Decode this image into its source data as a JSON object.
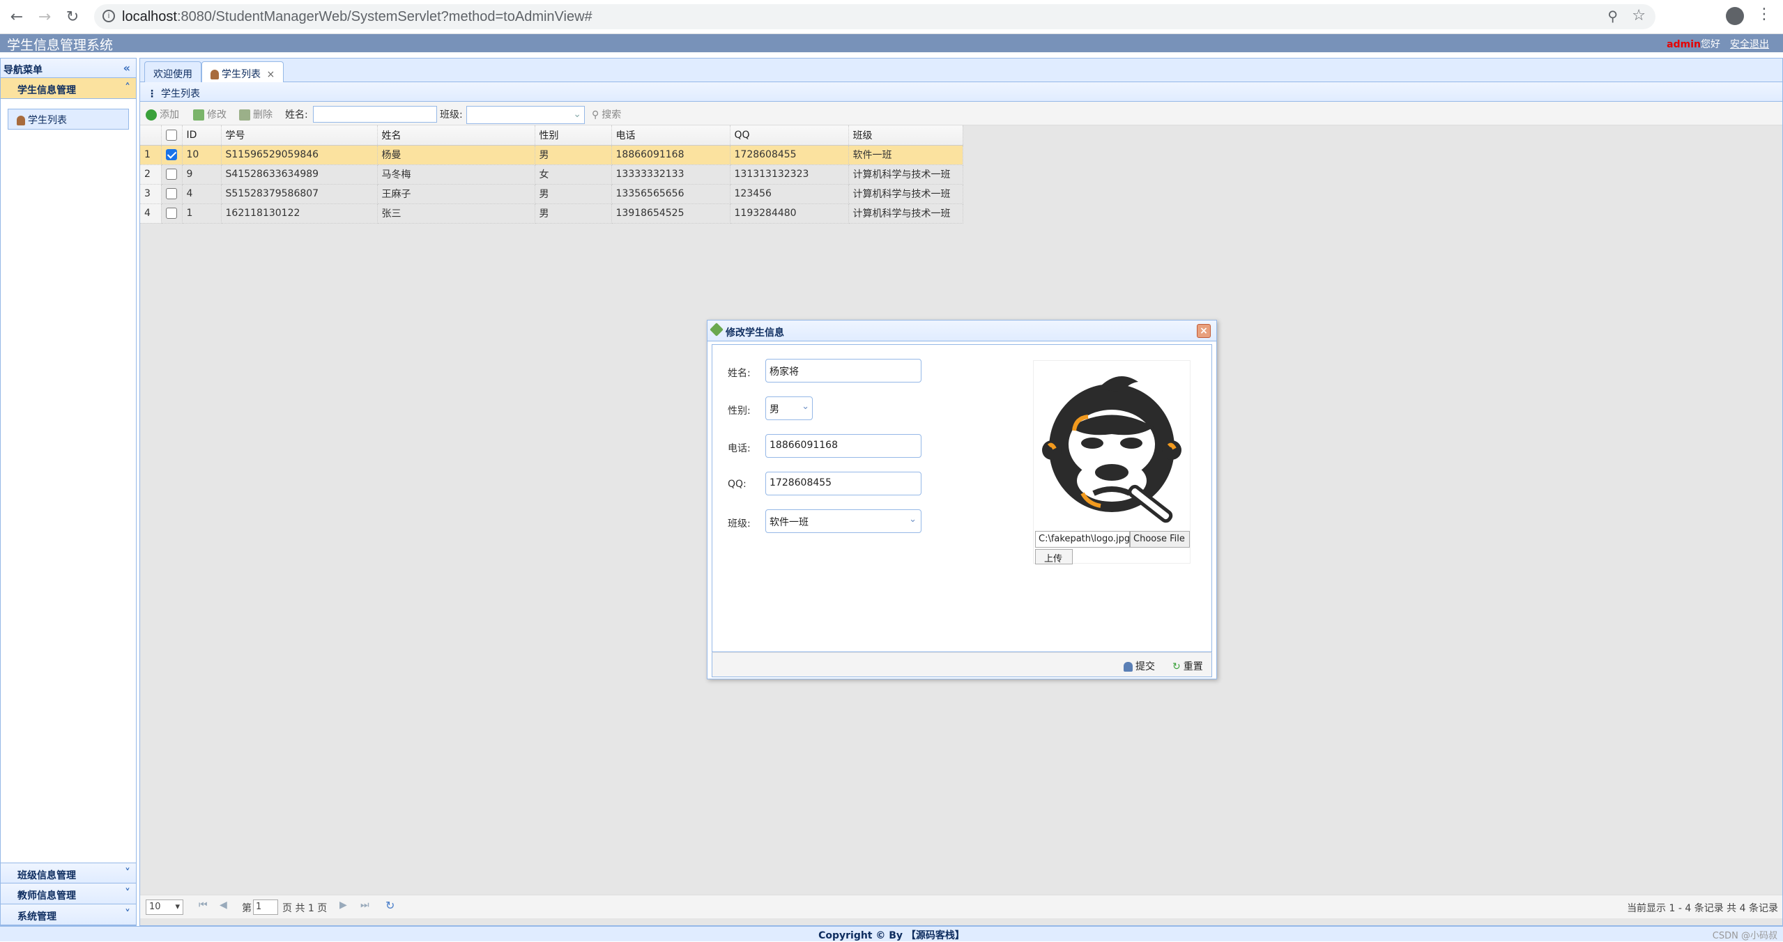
{
  "browser": {
    "url_host": "localhost",
    "url_rest": ":8080/StudentManagerWeb/SystemServlet?method=toAdminView#"
  },
  "app": {
    "title": "学生信息管理系统",
    "user": "admin",
    "greeting": "您好",
    "logout": "安全退出"
  },
  "nav": {
    "header": "导航菜单",
    "groups": [
      {
        "label": "学生信息管理",
        "items": [
          "学生列表"
        ]
      },
      {
        "label": "班级信息管理"
      },
      {
        "label": "教师信息管理"
      },
      {
        "label": "系统管理"
      }
    ]
  },
  "tabs": [
    {
      "label": "欢迎使用"
    },
    {
      "label": "学生列表"
    }
  ],
  "grid": {
    "title": "学生列表",
    "toolbar": {
      "add": "添加",
      "edit": "修改",
      "delete": "删除",
      "name_label": "姓名:",
      "class_label": "班级:",
      "search": "搜索"
    },
    "columns": [
      "ID",
      "学号",
      "姓名",
      "性别",
      "电话",
      "QQ",
      "班级"
    ],
    "rows": [
      {
        "num": "1",
        "checked": true,
        "cells": [
          "10",
          "S11596529059846",
          "杨曼",
          "男",
          "18866091168",
          "1728608455",
          "软件一班"
        ]
      },
      {
        "num": "2",
        "checked": false,
        "cells": [
          "9",
          "S41528633634989",
          "马冬梅",
          "女",
          "13333332133",
          "131313132323",
          "计算机科学与技术一班"
        ]
      },
      {
        "num": "3",
        "checked": false,
        "cells": [
          "4",
          "S51528379586807",
          "王麻子",
          "男",
          "13356565656",
          "123456",
          "计算机科学与技术一班"
        ]
      },
      {
        "num": "4",
        "checked": false,
        "cells": [
          "1",
          "162118130122",
          "张三",
          "男",
          "13918654525",
          "1193284480",
          "计算机科学与技术一班"
        ]
      }
    ],
    "pager": {
      "page_size": "10",
      "page_prefix": "第",
      "page_value": "1",
      "page_suffix": "页 共 1 页",
      "summary": "当前显示 1 - 4 条记录 共 4 条记录"
    }
  },
  "dialog": {
    "title": "修改学生信息",
    "fields": {
      "name_label": "姓名:",
      "name_value": "杨家将",
      "gender_label": "性别:",
      "gender_value": "男",
      "phone_label": "电话:",
      "phone_value": "18866091168",
      "qq_label": "QQ:",
      "qq_value": "1728608455",
      "class_label": "班级:",
      "class_value": "软件一班"
    },
    "file_path": "C:\\fakepath\\logo.jpg",
    "choose_file": "Choose File",
    "upload": "上传",
    "submit": "提交",
    "reset": "重置"
  },
  "footer": {
    "copyright": "Copyright © By 【源码客栈】",
    "watermark": "CSDN @小码叔"
  }
}
